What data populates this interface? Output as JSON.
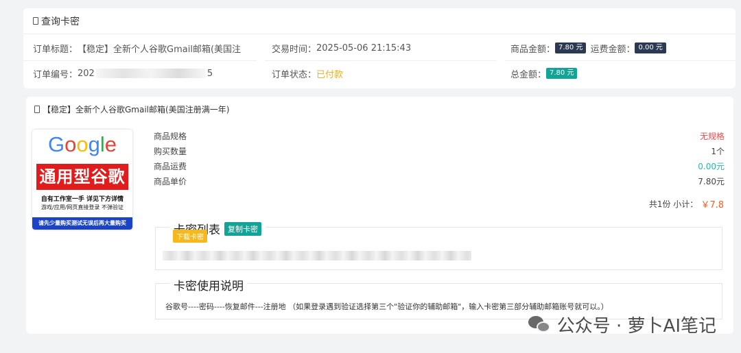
{
  "order_card": {
    "title": "查询卡密",
    "order_title_label": "订单标题：",
    "order_title_value": "【稳定】全新个人谷歌Gmail邮箱(美国注",
    "trade_time_label": "交易时间：",
    "trade_time_value": "2025-05-06 21:15:43",
    "goods_amount_label": "商品金额：",
    "goods_amount_value": "7.80 元",
    "shipping_amount_label": "运费金额：",
    "shipping_amount_value": "0.00 元",
    "order_no_label": "订单编号：",
    "order_no_prefix": "202",
    "order_no_suffix": "5",
    "order_status_label": "订单状态：",
    "order_status_value": "已付款",
    "total_label": "总金额：",
    "total_value": "7.80 元"
  },
  "product_card": {
    "title": "【稳定】全新个人谷歌Gmail邮箱(美国注册满一年)",
    "image": {
      "logo_letters": [
        "G",
        "o",
        "o",
        "g",
        "l",
        "e"
      ],
      "logo_colors": [
        "#4285F4",
        "#EA4335",
        "#FBBC05",
        "#4285F4",
        "#34A853",
        "#EA4335"
      ],
      "banner": "通用型谷歌",
      "line1": "自有工作室一手  详见下方详情",
      "line2": "游戏/应用/网页直接登录 不弹验证",
      "bottom": "请先少量购买测试无误后再大量购买"
    },
    "specs": [
      {
        "label": "商品规格",
        "value": "无规格"
      },
      {
        "label": "购买数量",
        "value": "1个"
      },
      {
        "label": "商品运费",
        "value": "0.00元"
      },
      {
        "label": "商品单价",
        "value": "7.80元"
      }
    ],
    "subtotal_text": "共1份 小计：",
    "subtotal_price": "￥7.8",
    "card_list": {
      "legend": "卡密列表",
      "copy_button": "复制卡密",
      "download_button": "下载卡密"
    },
    "usage": {
      "legend": "卡密使用说明",
      "text": "谷歌号----密码----恢复邮件---注册地 （如果登录遇到验证选择第三个\"验证你的辅助邮箱\"，输入卡密第三部分辅助邮箱账号就可以。）"
    }
  },
  "watermark": "公众号 · 萝卜AI笔记"
}
